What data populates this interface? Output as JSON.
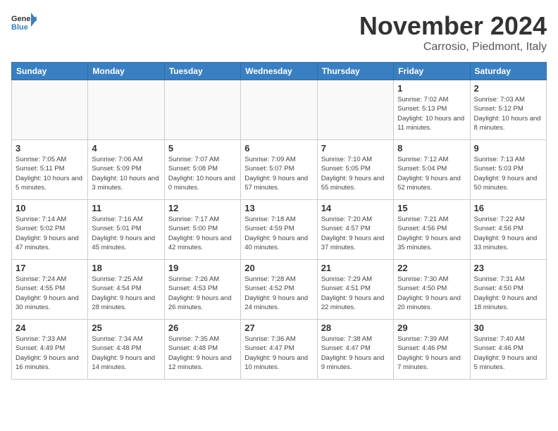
{
  "logo": {
    "line1": "General",
    "line2": "Blue"
  },
  "title": "November 2024",
  "subtitle": "Carrosio, Piedmont, Italy",
  "days_of_week": [
    "Sunday",
    "Monday",
    "Tuesday",
    "Wednesday",
    "Thursday",
    "Friday",
    "Saturday"
  ],
  "weeks": [
    [
      {
        "day": "",
        "info": ""
      },
      {
        "day": "",
        "info": ""
      },
      {
        "day": "",
        "info": ""
      },
      {
        "day": "",
        "info": ""
      },
      {
        "day": "",
        "info": ""
      },
      {
        "day": "1",
        "info": "Sunrise: 7:02 AM\nSunset: 5:13 PM\nDaylight: 10 hours and 11 minutes."
      },
      {
        "day": "2",
        "info": "Sunrise: 7:03 AM\nSunset: 5:12 PM\nDaylight: 10 hours and 8 minutes."
      }
    ],
    [
      {
        "day": "3",
        "info": "Sunrise: 7:05 AM\nSunset: 5:11 PM\nDaylight: 10 hours and 5 minutes."
      },
      {
        "day": "4",
        "info": "Sunrise: 7:06 AM\nSunset: 5:09 PM\nDaylight: 10 hours and 3 minutes."
      },
      {
        "day": "5",
        "info": "Sunrise: 7:07 AM\nSunset: 5:08 PM\nDaylight: 10 hours and 0 minutes."
      },
      {
        "day": "6",
        "info": "Sunrise: 7:09 AM\nSunset: 5:07 PM\nDaylight: 9 hours and 57 minutes."
      },
      {
        "day": "7",
        "info": "Sunrise: 7:10 AM\nSunset: 5:05 PM\nDaylight: 9 hours and 55 minutes."
      },
      {
        "day": "8",
        "info": "Sunrise: 7:12 AM\nSunset: 5:04 PM\nDaylight: 9 hours and 52 minutes."
      },
      {
        "day": "9",
        "info": "Sunrise: 7:13 AM\nSunset: 5:03 PM\nDaylight: 9 hours and 50 minutes."
      }
    ],
    [
      {
        "day": "10",
        "info": "Sunrise: 7:14 AM\nSunset: 5:02 PM\nDaylight: 9 hours and 47 minutes."
      },
      {
        "day": "11",
        "info": "Sunrise: 7:16 AM\nSunset: 5:01 PM\nDaylight: 9 hours and 45 minutes."
      },
      {
        "day": "12",
        "info": "Sunrise: 7:17 AM\nSunset: 5:00 PM\nDaylight: 9 hours and 42 minutes."
      },
      {
        "day": "13",
        "info": "Sunrise: 7:18 AM\nSunset: 4:59 PM\nDaylight: 9 hours and 40 minutes."
      },
      {
        "day": "14",
        "info": "Sunrise: 7:20 AM\nSunset: 4:57 PM\nDaylight: 9 hours and 37 minutes."
      },
      {
        "day": "15",
        "info": "Sunrise: 7:21 AM\nSunset: 4:56 PM\nDaylight: 9 hours and 35 minutes."
      },
      {
        "day": "16",
        "info": "Sunrise: 7:22 AM\nSunset: 4:56 PM\nDaylight: 9 hours and 33 minutes."
      }
    ],
    [
      {
        "day": "17",
        "info": "Sunrise: 7:24 AM\nSunset: 4:55 PM\nDaylight: 9 hours and 30 minutes."
      },
      {
        "day": "18",
        "info": "Sunrise: 7:25 AM\nSunset: 4:54 PM\nDaylight: 9 hours and 28 minutes."
      },
      {
        "day": "19",
        "info": "Sunrise: 7:26 AM\nSunset: 4:53 PM\nDaylight: 9 hours and 26 minutes."
      },
      {
        "day": "20",
        "info": "Sunrise: 7:28 AM\nSunset: 4:52 PM\nDaylight: 9 hours and 24 minutes."
      },
      {
        "day": "21",
        "info": "Sunrise: 7:29 AM\nSunset: 4:51 PM\nDaylight: 9 hours and 22 minutes."
      },
      {
        "day": "22",
        "info": "Sunrise: 7:30 AM\nSunset: 4:50 PM\nDaylight: 9 hours and 20 minutes."
      },
      {
        "day": "23",
        "info": "Sunrise: 7:31 AM\nSunset: 4:50 PM\nDaylight: 9 hours and 18 minutes."
      }
    ],
    [
      {
        "day": "24",
        "info": "Sunrise: 7:33 AM\nSunset: 4:49 PM\nDaylight: 9 hours and 16 minutes."
      },
      {
        "day": "25",
        "info": "Sunrise: 7:34 AM\nSunset: 4:48 PM\nDaylight: 9 hours and 14 minutes."
      },
      {
        "day": "26",
        "info": "Sunrise: 7:35 AM\nSunset: 4:48 PM\nDaylight: 9 hours and 12 minutes."
      },
      {
        "day": "27",
        "info": "Sunrise: 7:36 AM\nSunset: 4:47 PM\nDaylight: 9 hours and 10 minutes."
      },
      {
        "day": "28",
        "info": "Sunrise: 7:38 AM\nSunset: 4:47 PM\nDaylight: 9 hours and 9 minutes."
      },
      {
        "day": "29",
        "info": "Sunrise: 7:39 AM\nSunset: 4:46 PM\nDaylight: 9 hours and 7 minutes."
      },
      {
        "day": "30",
        "info": "Sunrise: 7:40 AM\nSunset: 4:46 PM\nDaylight: 9 hours and 5 minutes."
      }
    ]
  ]
}
